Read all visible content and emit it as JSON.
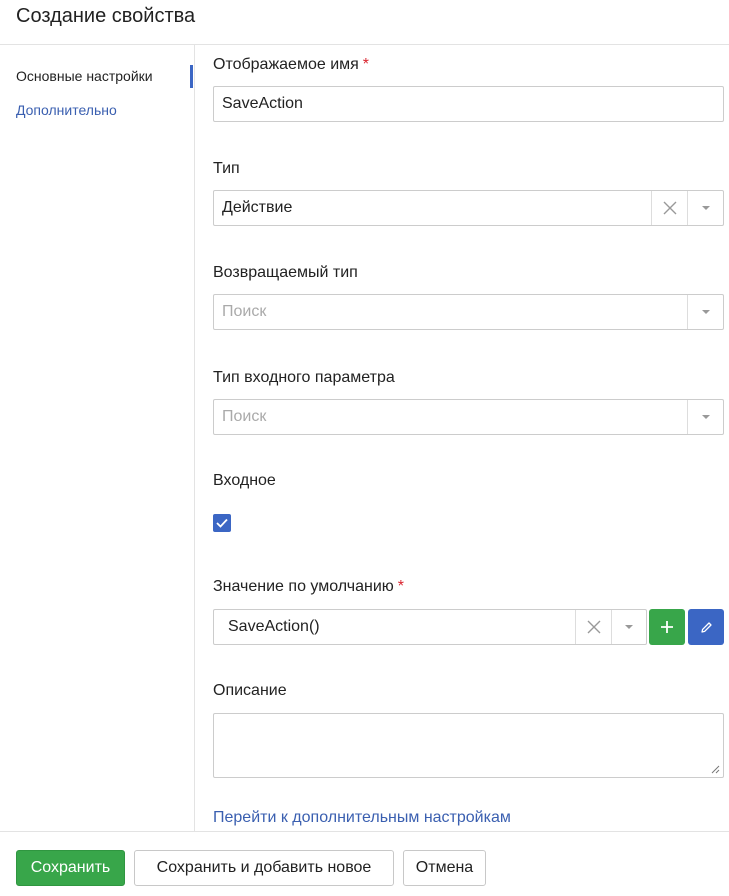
{
  "dialog": {
    "title": "Создание свойства"
  },
  "sidebar": {
    "items": [
      {
        "label": "Основные настройки",
        "active": true
      },
      {
        "label": "Дополнительно",
        "active": false
      }
    ]
  },
  "form": {
    "display_name": {
      "label": "Отображаемое имя",
      "required": "*",
      "value": "SaveAction"
    },
    "type": {
      "label": "Тип",
      "value": "Действие"
    },
    "return_type": {
      "label": "Возвращаемый тип",
      "placeholder": "Поиск"
    },
    "input_param_type": {
      "label": "Тип входного параметра",
      "placeholder": "Поиск"
    },
    "input": {
      "label": "Входное",
      "checked": true
    },
    "default_value": {
      "label": "Значение по умолчанию",
      "required": "*",
      "value": "SaveAction()"
    },
    "description": {
      "label": "Описание",
      "value": ""
    },
    "more_link": "Перейти к дополнительным настройкам"
  },
  "footer": {
    "save_label": "Сохранить",
    "save_and_add_label": "Сохранить и добавить новое",
    "cancel_label": "Отмена"
  },
  "colors": {
    "accent": "#3b66c4",
    "primary": "#38a64a",
    "required": "#d9232e",
    "link": "#3a5fb0"
  },
  "icons": [
    "clear-icon",
    "chevron-down-icon",
    "checkmark-icon",
    "plus-icon",
    "pencil-icon",
    "resize-handle-icon"
  ]
}
